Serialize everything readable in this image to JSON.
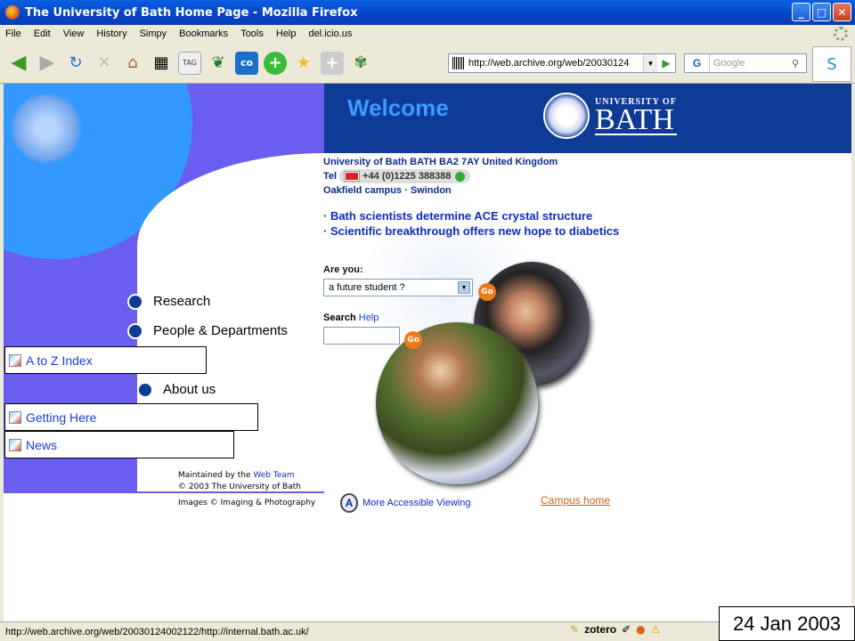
{
  "window": {
    "title": "The University of Bath Home Page - Mozilla Firefox"
  },
  "menu": [
    "File",
    "Edit",
    "View",
    "History",
    "Simpy",
    "Bookmarks",
    "Tools",
    "Help",
    "del.icio.us"
  ],
  "toolbar": {
    "url": "http://web.archive.org/web/20030124",
    "search_placeholder": "Google"
  },
  "page": {
    "welcome": "Welcome",
    "logo_small": "UNIVERSITY OF",
    "logo_big": "BATH",
    "address": "University of Bath BATH BA2 7AY United Kingdom",
    "tel_label": "Tel",
    "tel_number": "+44 (0)1225 388388",
    "campus_oakfield": "Oakfield campus",
    "campus_sep": " · ",
    "campus_swindon": "Swindon",
    "news": [
      "· Bath scientists determine ACE crystal structure",
      "· Scientific breakthrough offers new hope to diabetics"
    ],
    "are_you_label": "Are you:",
    "are_you_selected": "a future student ?",
    "go_label": "Go",
    "search_label": "Search",
    "search_help": "Help",
    "nav": {
      "research": "Research",
      "people": "People & Departments",
      "atoz": "A to Z Index",
      "about": "About us",
      "getting_here": "Getting Here",
      "news": "News"
    },
    "maintained_prefix": "Maintained by the ",
    "web_team": "Web Team",
    "copyright": "© 2003 The University of Bath",
    "images_credit": "Images © Imaging & Photography",
    "accessible": "More Accessible Viewing",
    "campus_home": "Campus home"
  },
  "status": {
    "text": "http://web.archive.org/web/20030124002122/http://internal.bath.ac.uk/",
    "zotero": "zotero"
  },
  "overlay_date": "24 Jan 2003",
  "colors": {
    "brand_navy": "#0d3b96",
    "light_blue": "#3399ff",
    "purple": "#6a5ef0",
    "link": "#1a3cd8",
    "go_orange": "#f07a1a"
  }
}
